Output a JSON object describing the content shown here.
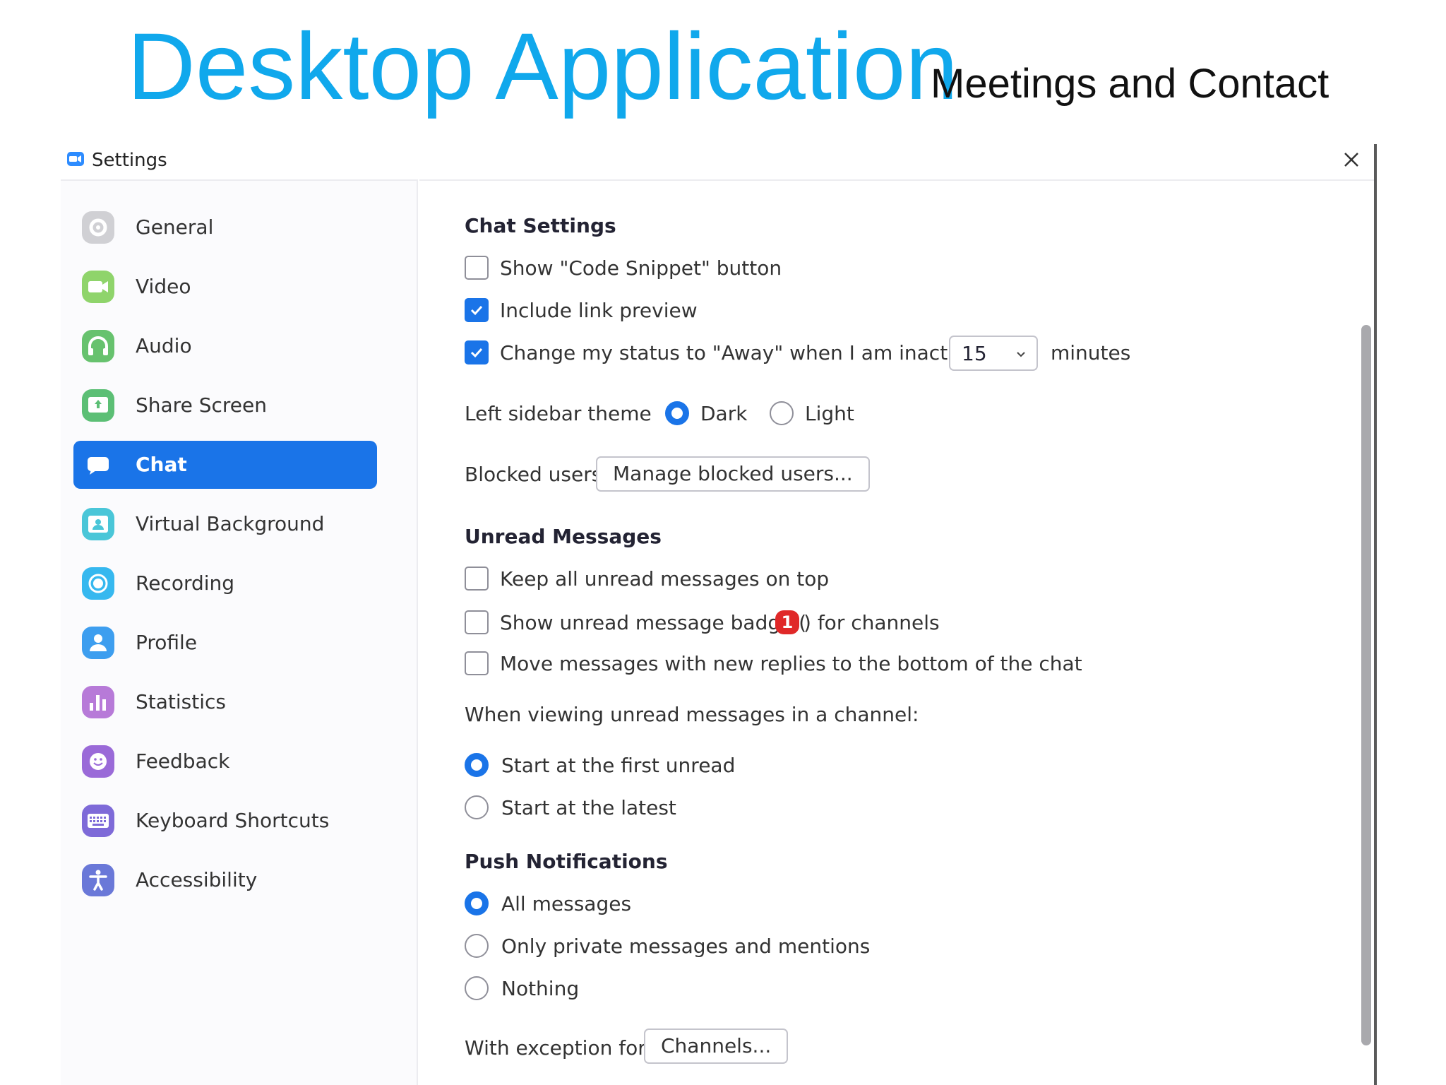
{
  "slide": {
    "title": "Desktop Application",
    "subtitle": "Meetings and Contact"
  },
  "window": {
    "title": "Settings"
  },
  "sidebar": {
    "items": [
      {
        "label": "General",
        "icon": "gear-icon",
        "color": "#c8c8cc",
        "active": false
      },
      {
        "label": "Video",
        "icon": "video-camera-icon",
        "color": "#8fd46b",
        "active": false
      },
      {
        "label": "Audio",
        "icon": "headphones-icon",
        "color": "#67c26e",
        "active": false
      },
      {
        "label": "Share Screen",
        "icon": "share-screen-icon",
        "color": "#5cbf75",
        "active": false
      },
      {
        "label": "Chat",
        "icon": "chat-bubble-icon",
        "color": "#ffffff",
        "active": true
      },
      {
        "label": "Virtual Background",
        "icon": "virtual-background-icon",
        "color": "#4ac6d8",
        "active": false
      },
      {
        "label": "Recording",
        "icon": "recording-icon",
        "color": "#36b8ef",
        "active": false
      },
      {
        "label": "Profile",
        "icon": "profile-icon",
        "color": "#3d9eef",
        "active": false
      },
      {
        "label": "Statistics",
        "icon": "statistics-icon",
        "color": "#b77ad8",
        "active": false
      },
      {
        "label": "Feedback",
        "icon": "feedback-icon",
        "color": "#9a6ad8",
        "active": false
      },
      {
        "label": "Keyboard Shortcuts",
        "icon": "keyboard-icon",
        "color": "#7e6ad8",
        "active": false
      },
      {
        "label": "Accessibility",
        "icon": "accessibility-icon",
        "color": "#6a78d8",
        "active": false
      }
    ]
  },
  "chat_settings": {
    "title": "Chat Settings",
    "code_snippet": {
      "label": "Show \"Code Snippet\" button",
      "checked": false
    },
    "link_preview": {
      "label": "Include link preview",
      "checked": true
    },
    "away_status": {
      "label": "Change my status to \"Away\" when I am inactive for",
      "checked": true,
      "value": "15",
      "suffix": "minutes"
    },
    "sidebar_theme": {
      "label": "Left sidebar theme",
      "options": [
        "Dark",
        "Light"
      ],
      "selected": "Dark"
    },
    "blocked_users": {
      "label": "Blocked users",
      "button": "Manage blocked users..."
    }
  },
  "unread_messages": {
    "title": "Unread Messages",
    "keep_on_top": {
      "label": "Keep all unread messages on top",
      "checked": false
    },
    "badge": {
      "label_before": "Show unread message badge (",
      "badge_count": "1",
      "label_after": ") for channels",
      "checked": false
    },
    "move_replies": {
      "label": "Move messages with new replies to the bottom of the chat",
      "checked": false
    },
    "viewing_label": "When viewing unread messages in a channel:",
    "viewing_options": [
      "Start at the first unread",
      "Start at the latest"
    ],
    "viewing_selected": "Start at the first unread"
  },
  "push_notifications": {
    "title": "Push Notifications",
    "options": [
      "All messages",
      "Only private messages and mentions",
      "Nothing"
    ],
    "selected": "All messages",
    "exception_label": "With exception for",
    "exception_button": "Channels..."
  },
  "colors": {
    "accent": "#1a74e8",
    "title_blue": "#10a8ec",
    "badge_red": "#e02828"
  }
}
